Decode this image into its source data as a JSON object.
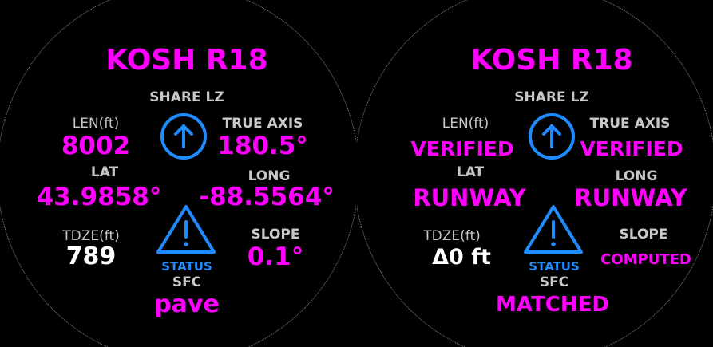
{
  "colors": {
    "accent": "#ff00ff",
    "label": "#c8c8c8",
    "value_white": "#ffffff",
    "status_blue": "#1e8cff",
    "background": "#000000"
  },
  "icons": {
    "share": "arrow-up-circle-icon",
    "status": "warning-triangle-icon"
  },
  "left": {
    "title": "KOSH R18",
    "share_label": "SHARE LZ",
    "len_label": "LEN(ft)",
    "len_value": "8002",
    "axis_label": "TRUE AXIS",
    "axis_value": "180.5°",
    "lat_label": "LAT",
    "lat_value": "43.9858°",
    "long_label": "LONG",
    "long_value": "-88.5564°",
    "tdze_label": "TDZE(ft)",
    "tdze_value": "789",
    "slope_label": "SLOPE",
    "slope_value": "0.1°",
    "status_label": "STATUS",
    "sfc_label": "SFC",
    "sfc_value": "pave"
  },
  "right": {
    "title": "KOSH R18",
    "share_label": "SHARE LZ",
    "len_label": "LEN(ft)",
    "len_value": "VERIFIED",
    "axis_label": "TRUE AXIS",
    "axis_value": "VERIFIED",
    "lat_label": "LAT",
    "lat_value": "RUNWAY",
    "long_label": "LONG",
    "long_value": "RUNWAY",
    "tdze_label": "TDZE(ft)",
    "tdze_value": "Δ0 ft",
    "slope_label": "SLOPE",
    "slope_value": "COMPUTED",
    "status_label": "STATUS",
    "sfc_label": "SFC",
    "sfc_value": "MATCHED"
  }
}
